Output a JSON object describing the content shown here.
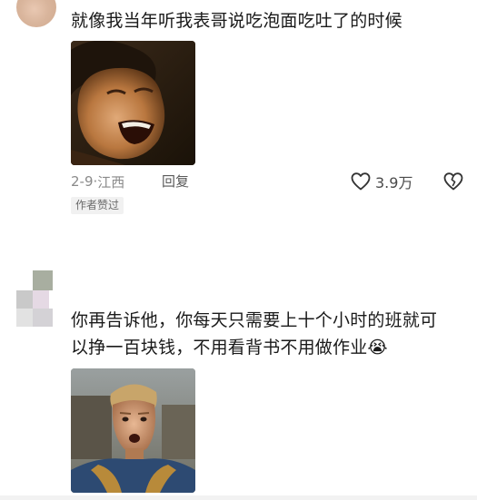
{
  "comments": [
    {
      "text": "就像我当年听我表哥说吃泡面吃吐了的时候",
      "date": "2-9",
      "location": "江西",
      "meta_separator": " · ",
      "reply_label": "回复",
      "like_count": "3.9万",
      "author_badge": "作者赞过",
      "icons": [
        "heart-outline-icon",
        "broken-heart-icon"
      ]
    },
    {
      "text_line1": "你再告诉他，你每天只需要上十个小时的班就可",
      "text_line2": "以挣一百块钱，不用看背书不用做作业",
      "emoji": "😭"
    }
  ],
  "colors": {
    "meta_text": "#8a8a8a",
    "badge_bg": "#f1f1f1",
    "text": "#1a1a1a"
  }
}
